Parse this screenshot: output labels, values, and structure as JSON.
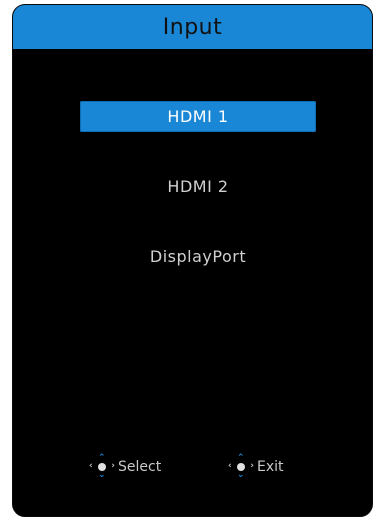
{
  "osd": {
    "title": "Input",
    "items": [
      {
        "label": "HDMI 1",
        "selected": true
      },
      {
        "label": "HDMI 2",
        "selected": false
      },
      {
        "label": "DisplayPort",
        "selected": false
      }
    ],
    "hints": {
      "select_label": "Select",
      "exit_label": "Exit",
      "select_icon": "joystick-press-icon",
      "exit_icon": "joystick-icon"
    },
    "colors": {
      "accent": "#1a86d6",
      "background": "#000000",
      "text": "#d0d0d0"
    }
  }
}
